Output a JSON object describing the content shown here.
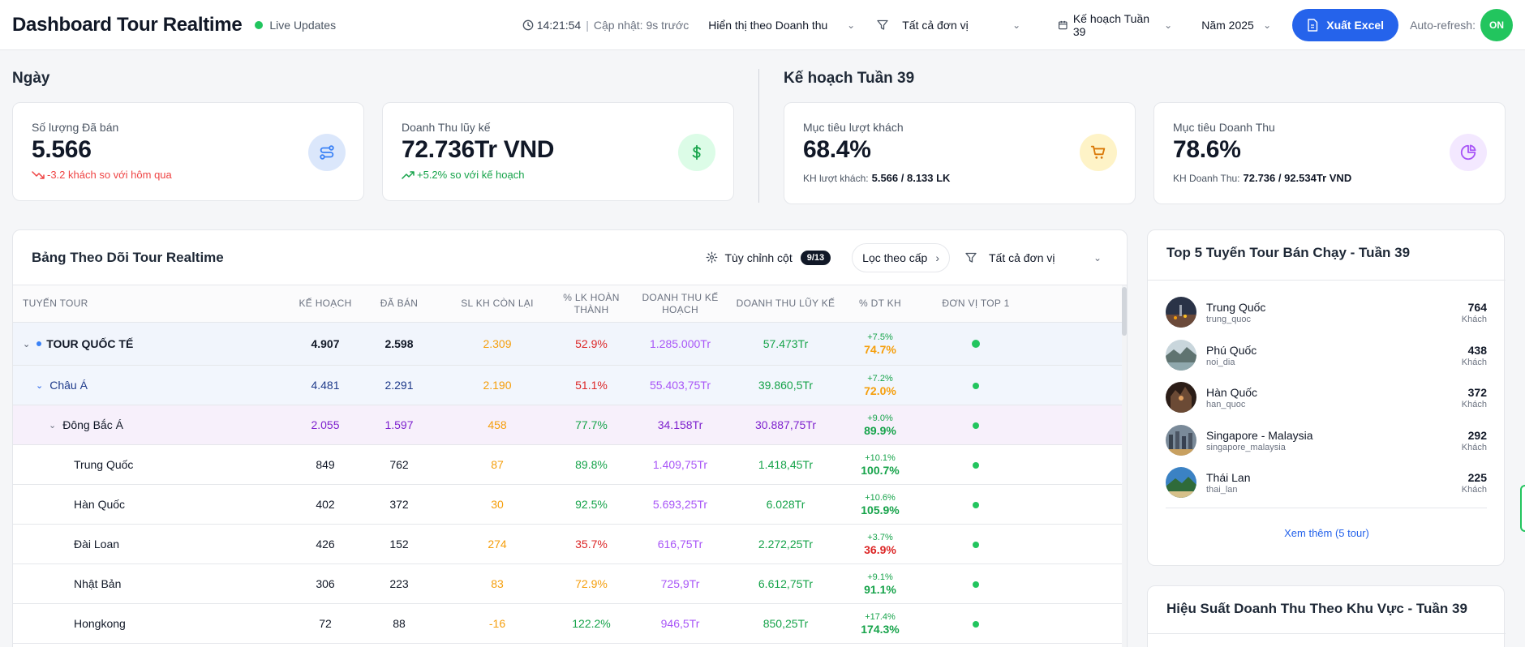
{
  "header": {
    "title": "Dashboard Tour Realtime",
    "live_label": "Live Updates",
    "time": "14:21:54",
    "sep": "|",
    "update_text": "Cập nhật: 9s trước",
    "display_select": "Hiển thị theo Doanh thu",
    "unit_select": "Tất cả đơn vị",
    "plan_select": "Kế hoạch Tuần 39",
    "year_select": "Năm 2025",
    "export_label": "Xuất Excel",
    "auto_refresh_label": "Auto-refresh:",
    "auto_refresh_state": "ON"
  },
  "sections": {
    "day_title": "Ngày",
    "plan_title": "Kế hoạch Tuần 39"
  },
  "kpis": {
    "sold": {
      "label": "Số lượng Đã bán",
      "value": "5.566",
      "sub": "-3.2 khách so với hôm qua"
    },
    "revenue": {
      "label": "Doanh Thu lũy kế",
      "value": "72.736Tr VND",
      "sub": "+5.2% so với kế hoạch"
    },
    "guest_target": {
      "label": "Mục tiêu lượt khách",
      "value": "68.4%",
      "sub_label": "KH lượt khách:",
      "sub_value": "5.566 / 8.133 LK"
    },
    "revenue_target": {
      "label": "Mục tiêu Doanh Thu",
      "value": "78.6%",
      "sub_label": "KH Doanh Thu:",
      "sub_value": "72.736 / 92.534Tr VND"
    }
  },
  "table": {
    "title": "Bảng Theo Dõi Tour Realtime",
    "customize_label": "Tùy chỉnh cột",
    "customize_badge": "9/13",
    "filter_level_label": "Lọc theo cấp",
    "unit_select": "Tất cả đơn vị",
    "headers": [
      "Tuyến Tour",
      "Kế Hoạch",
      "Đã Bán",
      "SL KH Còn Lại",
      "% LK Hoàn Thành",
      "Doanh Thu Kế Hoạch",
      "Doanh Thu Lũy Kế",
      "% DT KH",
      "Đơn Vị Top 1"
    ],
    "rows": [
      {
        "name": "TOUR QUỐC TẾ",
        "plan": "4.907",
        "sold": "2.598",
        "remain": "2.309",
        "pct": "52.9%",
        "rev_plan": "1.285.000Tr",
        "rev_acc": "57.473Tr",
        "dt_delta": "+7.5%",
        "dt_pct": "74.7%"
      },
      {
        "name": "Châu Á",
        "plan": "4.481",
        "sold": "2.291",
        "remain": "2.190",
        "pct": "51.1%",
        "rev_plan": "55.403,75Tr",
        "rev_acc": "39.860,5Tr",
        "dt_delta": "+7.2%",
        "dt_pct": "72.0%"
      },
      {
        "name": "Đông Bắc Á",
        "plan": "2.055",
        "sold": "1.597",
        "remain": "458",
        "pct": "77.7%",
        "rev_plan": "34.158Tr",
        "rev_acc": "30.887,75Tr",
        "dt_delta": "+9.0%",
        "dt_pct": "89.9%"
      },
      {
        "name": "Trung Quốc",
        "plan": "849",
        "sold": "762",
        "remain": "87",
        "pct": "89.8%",
        "rev_plan": "1.409,75Tr",
        "rev_acc": "1.418,45Tr",
        "dt_delta": "+10.1%",
        "dt_pct": "100.7%"
      },
      {
        "name": "Hàn Quốc",
        "plan": "402",
        "sold": "372",
        "remain": "30",
        "pct": "92.5%",
        "rev_plan": "5.693,25Tr",
        "rev_acc": "6.028Tr",
        "dt_delta": "+10.6%",
        "dt_pct": "105.9%"
      },
      {
        "name": "Đài Loan",
        "plan": "426",
        "sold": "152",
        "remain": "274",
        "pct": "35.7%",
        "rev_plan": "616,75Tr",
        "rev_acc": "2.272,25Tr",
        "dt_delta": "+3.7%",
        "dt_pct": "36.9%"
      },
      {
        "name": "Nhật Bản",
        "plan": "306",
        "sold": "223",
        "remain": "83",
        "pct": "72.9%",
        "rev_plan": "725,9Tr",
        "rev_acc": "6.612,75Tr",
        "dt_delta": "+9.1%",
        "dt_pct": "91.1%"
      },
      {
        "name": "Hongkong",
        "plan": "72",
        "sold": "88",
        "remain": "-16",
        "pct": "122.2%",
        "rev_plan": "946,5Tr",
        "rev_acc": "850,25Tr",
        "dt_delta": "+17.4%",
        "dt_pct": "174.3%"
      }
    ]
  },
  "top5": {
    "title": "Top 5 Tuyến Tour Bán Chạy - Tuần 39",
    "items": [
      {
        "name": "Trung Quốc",
        "slug": "trung_quoc",
        "count": "764",
        "unit": "Khách"
      },
      {
        "name": "Phú Quốc",
        "slug": "noi_dia",
        "count": "438",
        "unit": "Khách"
      },
      {
        "name": "Hàn Quốc",
        "slug": "han_quoc",
        "count": "372",
        "unit": "Khách"
      },
      {
        "name": "Singapore - Malaysia",
        "slug": "singapore_malaysia",
        "count": "292",
        "unit": "Khách"
      },
      {
        "name": "Thái Lan",
        "slug": "thai_lan",
        "count": "225",
        "unit": "Khách"
      }
    ],
    "more_label": "Xem thêm (5 tour)"
  },
  "performance": {
    "title": "Hiệu Suất Doanh Thu Theo Khu Vực - Tuần 39"
  }
}
